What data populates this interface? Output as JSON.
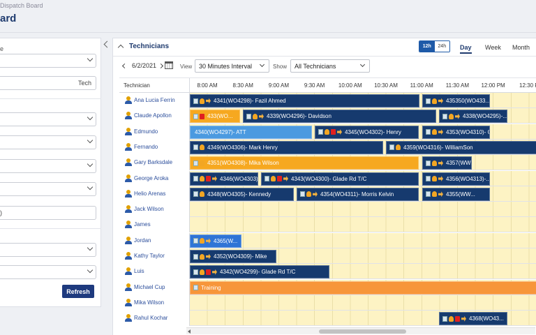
{
  "header": {
    "breadcrumb": "Dispatch Board",
    "title": "ard"
  },
  "filters": {
    "label1": "e",
    "tech_field_text": "Tech",
    "partial_text": ")",
    "refresh_label": "Refresh"
  },
  "panel": {
    "title": "Technicians",
    "format_12": "12h",
    "format_24": "24h",
    "tabs": [
      "Day",
      "Week",
      "Month"
    ],
    "active_tab": "Day",
    "date": "6/2/2021",
    "view_label": "View",
    "view_value": "30 Minutes Interval",
    "show_label": "Show",
    "show_value": "All Technicians"
  },
  "grid": {
    "tech_header": "Technician",
    "times": [
      "8:00 AM",
      "8:30 AM",
      "9:00 AM",
      "9:30 AM",
      "10:00 AM",
      "10:30 AM",
      "11:00 AM",
      "11:30 AM",
      "12:00 PM",
      "12:30 P"
    ],
    "technicians": [
      "Ana Lucia Ferrin",
      "Claude Apollon",
      "Edmundo",
      "Fernando",
      "Gary Barksdale",
      "George Aroka",
      "Helio Arenas",
      "Jack Wilson",
      "James",
      "Jordan",
      "Kathy Taylor",
      "Luis",
      "Michael Cup",
      "Mika Wilson",
      "Rahul Kochar"
    ],
    "events": [
      {
        "row": 0,
        "start": 0,
        "end": 329,
        "color": "navy",
        "icons": [
          "doc",
          "bell",
          "truck"
        ],
        "label": "4341(WO4298)- Fazil Ahmed"
      },
      {
        "row": 0,
        "start": 333,
        "end": 430,
        "color": "navy",
        "icons": [
          "doc",
          "bell",
          "truck"
        ],
        "label": "435350(WO433..."
      },
      {
        "row": 1,
        "start": 0,
        "end": 72,
        "color": "orange",
        "icons": [
          "doc",
          "alert"
        ],
        "label": "433(WO..."
      },
      {
        "row": 1,
        "start": 76,
        "end": 353,
        "color": "navy",
        "icons": [
          "doc",
          "bell",
          "truck"
        ],
        "label": "4339(WO4296)- Davidson"
      },
      {
        "row": 1,
        "start": 357,
        "end": 455,
        "color": "navy",
        "icons": [
          "doc",
          "bell",
          "truck"
        ],
        "label": "4338(WO4295)-..."
      },
      {
        "row": 2,
        "start": 0,
        "end": 175,
        "color": "blue",
        "icons": [],
        "label": "4340(WO4297)- ATT"
      },
      {
        "row": 2,
        "start": 179,
        "end": 328,
        "color": "navy",
        "icons": [
          "doc",
          "bell",
          "alert",
          "truck"
        ],
        "label": "4345(WO4302)- Henry"
      },
      {
        "row": 2,
        "start": 333,
        "end": 430,
        "color": "navy",
        "icons": [
          "doc",
          "bell",
          "truck"
        ],
        "label": "4353(WO4310)- Gla..."
      },
      {
        "row": 3,
        "start": 0,
        "end": 277,
        "color": "navy",
        "icons": [
          "doc",
          "bell"
        ],
        "label": "4349(WO4306)- Mark Henry"
      },
      {
        "row": 3,
        "start": 281,
        "end": 499,
        "color": "navy",
        "icons": [
          "doc",
          "bell"
        ],
        "label": "4359(WO4316)- WilliamSon"
      },
      {
        "row": 4,
        "start": 0,
        "end": 328,
        "color": "orange",
        "icons": [
          "doc",
          "bell"
        ],
        "label": "4351(WO4308)- Mika Wilson"
      },
      {
        "row": 4,
        "start": 333,
        "end": 404,
        "color": "navy",
        "icons": [
          "doc",
          "bell",
          "truck"
        ],
        "label": "4357(WW..."
      },
      {
        "row": 5,
        "start": 0,
        "end": 98,
        "color": "navy",
        "icons": [
          "doc",
          "bell",
          "alert",
          "truck"
        ],
        "label": "4346(WO4303)-..."
      },
      {
        "row": 5,
        "start": 102,
        "end": 328,
        "color": "navy",
        "icons": [
          "doc",
          "bell",
          "alert",
          "truck"
        ],
        "label": "4343(WO4300)- Glade Rd T/C"
      },
      {
        "row": 5,
        "start": 333,
        "end": 430,
        "color": "navy",
        "icons": [
          "doc",
          "bell",
          "truck"
        ],
        "label": "4356(WO4313)-..."
      },
      {
        "row": 6,
        "start": 0,
        "end": 149,
        "color": "navy",
        "icons": [
          "doc",
          "bell"
        ],
        "label": "4348(WO4305)- Kennedy"
      },
      {
        "row": 6,
        "start": 153,
        "end": 328,
        "color": "navy",
        "icons": [
          "doc",
          "bell",
          "truck"
        ],
        "label": "4354(WO4311)- Morris Kelvin"
      },
      {
        "row": 6,
        "start": 333,
        "end": 430,
        "color": "navy",
        "icons": [
          "doc",
          "bell",
          "truck"
        ],
        "label": "4355(WW..."
      },
      {
        "row": 9,
        "start": 0,
        "end": 74,
        "color": "bright",
        "icons": [
          "doc",
          "bell",
          "truck"
        ],
        "label": "4365(W..."
      },
      {
        "row": 10,
        "start": 0,
        "end": 124,
        "color": "navy",
        "icons": [
          "doc",
          "bell",
          "truck"
        ],
        "label": "4352(WO4309)- Mike"
      },
      {
        "row": 11,
        "start": 0,
        "end": 200,
        "color": "navy",
        "icons": [
          "doc",
          "bell",
          "alert",
          "truck"
        ],
        "label": "4342(WO4299)- Glade Rd T/C"
      },
      {
        "row": 12,
        "start": 0,
        "end": 499,
        "color": "training",
        "icons": [
          "doc"
        ],
        "label": "Training"
      },
      {
        "row": 14,
        "start": 357,
        "end": 455,
        "color": "navy",
        "icons": [
          "doc",
          "bell",
          "alert",
          "truck"
        ],
        "label": "4368(WO43..."
      }
    ]
  }
}
